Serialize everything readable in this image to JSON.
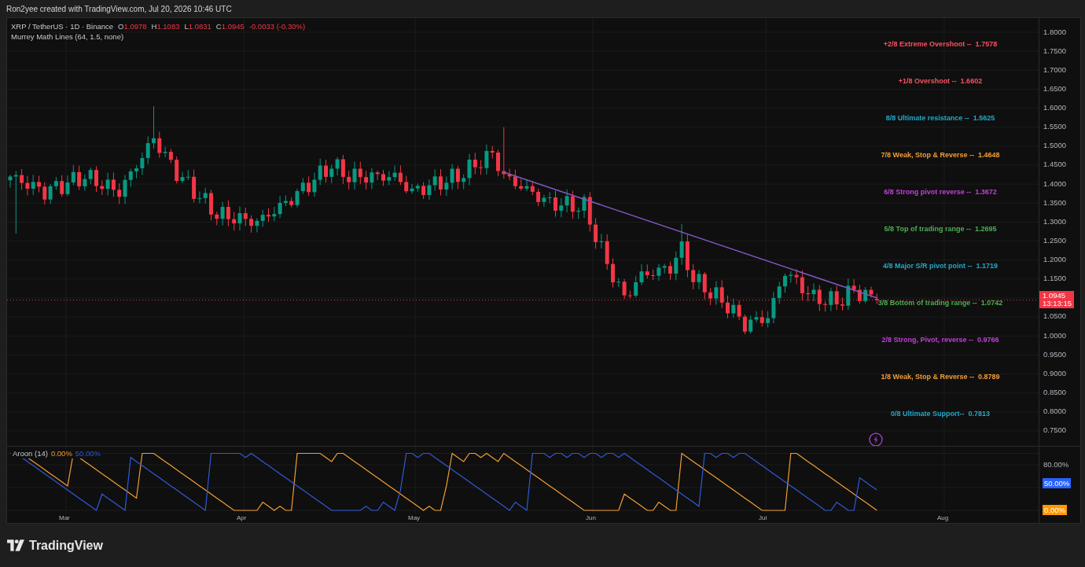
{
  "header": {
    "caption": "Ron2yee created with TradingView.com, Jul 20, 2026 10:46 UTC"
  },
  "legend": {
    "symbol": "XRP / TetherUS · 1D · Binance",
    "ohlc": [
      {
        "label": "O",
        "value": "1.0978"
      },
      {
        "label": "H",
        "value": "1.1083"
      },
      {
        "label": "L",
        "value": "1.0831"
      },
      {
        "label": "C",
        "value": "1.0945"
      }
    ],
    "change": "-0.0033 (-0.30%)",
    "indicator": "Murrey Math Lines (64, 1.5, none)"
  },
  "murrey_levels": [
    {
      "text": "+2/8 Extreme Overshoot --  1.7578",
      "color": "#f7525f"
    },
    {
      "text": "+1/8 Overshoot --  1.6602",
      "color": "#f7525f"
    },
    {
      "text": "8/8 Ultimate resistance --  1.5625",
      "color": "#22a9c9"
    },
    {
      "text": "7/8 Weak, Stop & Reverse --  1.4648",
      "color": "#f59d35"
    },
    {
      "text": "6/8 Strong pivot reverse --  1.3672",
      "color": "#c040d8"
    },
    {
      "text": "5/8 Top of trading range --  1.2695",
      "color": "#4caf50"
    },
    {
      "text": "4/8 Major S/R pivot point --  1.1719",
      "color": "#22a9c9"
    },
    {
      "text": "3/8 Bottom of trading range --  1.0742",
      "color": "#4caf50"
    },
    {
      "text": "2/8 Strong, Pivot, reverse --  0.9766",
      "color": "#c040d8"
    },
    {
      "text": "1/8 Weak, Stop & Reverse --  0.8789",
      "color": "#f59d35"
    },
    {
      "text": "0/8 Ultimate Support--  0.7813",
      "color": "#22a9c9"
    }
  ],
  "price_axis": {
    "ticks_upper": [
      "1.8000",
      "1.7500",
      "1.7000",
      "1.6500",
      "1.6000",
      "1.5500",
      "1.5000",
      "1.4500",
      "1.4000",
      "1.3500",
      "1.3000",
      "1.2500",
      "1.2000",
      "1.1500"
    ],
    "ticks_lower": [
      "1.0500",
      "1.0000",
      "0.9500",
      "0.9000",
      "0.8500",
      "0.8000",
      "0.7500"
    ],
    "last_price": "1.0945",
    "countdown": "13:13:15"
  },
  "aroon": {
    "title": "Aroon (14)",
    "up_value": "0.00%",
    "down_value": "50.00%",
    "axis_label": "80.00%",
    "down_badge": "50.00%",
    "up_badge": "0.00%"
  },
  "time_axis": [
    "Mar",
    "Apr",
    "May",
    "Jun",
    "Jul",
    "Aug"
  ],
  "footer": {
    "brand": "TradingView"
  }
}
